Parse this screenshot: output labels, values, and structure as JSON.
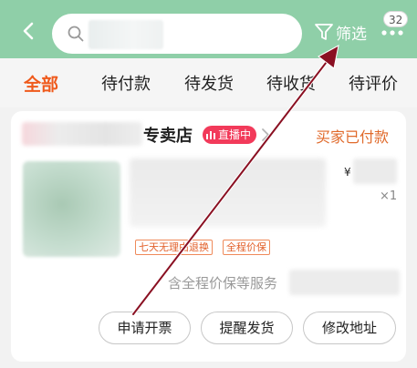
{
  "header": {
    "back_icon": "chevron-left-icon",
    "search_icon": "search-icon",
    "filter_label": "筛选",
    "filter_icon": "funnel-icon",
    "more_icon": "more-dots-icon",
    "badge_count": "32"
  },
  "tabs": [
    {
      "label": "全部",
      "active": true
    },
    {
      "label": "待付款",
      "active": false
    },
    {
      "label": "待发货",
      "active": false
    },
    {
      "label": "待收货",
      "active": false
    },
    {
      "label": "待评价",
      "active": false
    }
  ],
  "order": {
    "shop_suffix": "专卖店",
    "live_label": "直播中",
    "status": "买家已付款",
    "currency": "¥",
    "quantity": "×1",
    "tags": [
      "七天无理由退换",
      "全程价保"
    ],
    "service_text": "含全程价保等服务",
    "buttons": [
      "申请开票",
      "提醒发货",
      "修改地址"
    ]
  },
  "colors": {
    "header_bg": "#8fcfa8",
    "accent": "#ef5a1c",
    "live_badge": "#f23a5a",
    "status": "#e06a2b",
    "arrow": "#8a1022"
  }
}
